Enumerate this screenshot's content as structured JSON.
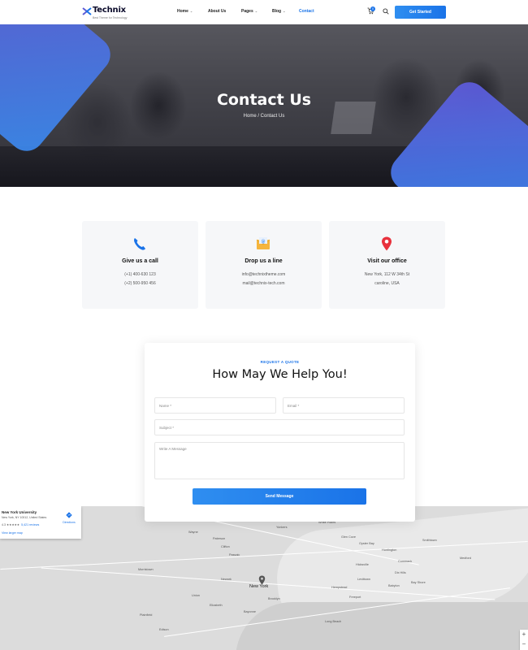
{
  "brand": {
    "name": "Technix",
    "tagline": "Best Theme for Technology"
  },
  "nav": {
    "items": [
      {
        "label": "Home",
        "dropdown": true
      },
      {
        "label": "About Us",
        "dropdown": false
      },
      {
        "label": "Pages",
        "dropdown": true
      },
      {
        "label": "Blog",
        "dropdown": true
      },
      {
        "label": "Contact",
        "dropdown": false,
        "active": true
      }
    ],
    "cart_count": "0",
    "cta": "Get Started"
  },
  "hero": {
    "title": "Contact Us",
    "breadcrumb": "Home / Contact Us"
  },
  "cards": [
    {
      "icon": "phone-icon",
      "title": "Give us a call",
      "lines": [
        "(+1) 400-630 123",
        "(+2) 500-950 456"
      ]
    },
    {
      "icon": "envelope-icon",
      "title": "Drop us a line",
      "lines": [
        "info@technixtheme.com",
        "mail@technix-tech.com"
      ]
    },
    {
      "icon": "location-pin-icon",
      "title": "Visit our office",
      "lines": [
        "New York, 112 W 34th St",
        "caroline, USA"
      ]
    }
  ],
  "form": {
    "eyebrow": "REQUEST A QUOTE",
    "title": "How May We Help You!",
    "name_placeholder": "Name *",
    "email_placeholder": "Email *",
    "subject_placeholder": "Subject *",
    "message_placeholder": "Write A Message",
    "submit": "Send Message"
  },
  "map": {
    "place_name": "New York University",
    "address": "New York, NY 10012, United States",
    "rating": "4.3 ★★★★★",
    "reviews": "5,421 reviews",
    "larger_map": "View larger map",
    "directions": "Directions",
    "labels": {
      "new_york": "New York",
      "newark": "Newark",
      "yonkers": "Yonkers",
      "paterson": "Paterson",
      "passaic": "Passaic",
      "clifton": "Clifton",
      "elizabeth": "Elizabeth",
      "bayonne": "Bayonne",
      "hempstead": "Hempstead",
      "levittown": "Levittown",
      "huntington": "Huntington",
      "hicksville": "Hicksville",
      "brooklyn": "Brooklyn",
      "freeport": "Freeport",
      "babylon": "Babylon",
      "medford": "Medford",
      "smithtown": "Smithtown",
      "commack": "Commack",
      "dix_hills": "Dix Hills",
      "bay_shore": "Bay Shore",
      "scarsdale": "Scarsdale",
      "white_plains": "White Plains",
      "wayne": "Wayne",
      "morristown": "Morristown",
      "edison": "Edison",
      "plainfield": "Plainfield",
      "union": "Union",
      "long_beach": "Long Beach",
      "oyster_bay": "Oyster Bay",
      "glen_cove": "Glen Cove"
    },
    "zoom_in": "+",
    "zoom_out": "−"
  }
}
